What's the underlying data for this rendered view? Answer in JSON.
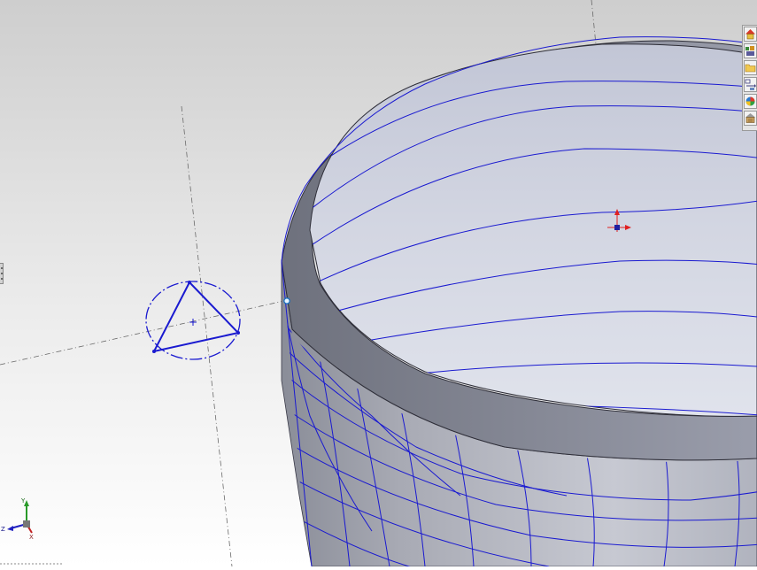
{
  "viewport": {
    "background_top": "#cfcfcf",
    "background_bottom": "#ffffff",
    "model_edge_color": "#1a1ad0",
    "origin_marker_color": "#e02020"
  },
  "triad": {
    "y_label": "Y",
    "z_label": "Z",
    "x_label": "X"
  },
  "task_pane": {
    "icons": [
      "home-icon",
      "design-library-icon",
      "file-explorer-icon",
      "view-palette-icon",
      "appearances-icon",
      "custom-properties-icon"
    ]
  }
}
